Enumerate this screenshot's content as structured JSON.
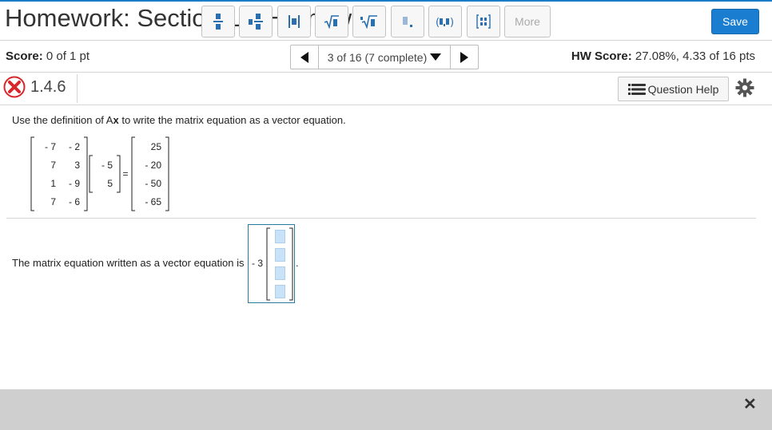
{
  "header": {
    "title": "Homework: Section 1.4 Homework",
    "save_label": "Save"
  },
  "status": {
    "score_label": "Score:",
    "score_value": "0 of 1 pt",
    "progress_text": "3 of 16 (7 complete)",
    "hw_score_label": "HW Score:",
    "hw_score_value": "27.08%, 4.33 of 16 pts"
  },
  "question": {
    "number": "1.4.6",
    "result": "incorrect",
    "help_label": "Question Help",
    "instruction_pre": "Use the definition of A",
    "instruction_bold": "x",
    "instruction_post": " to write the matrix equation as a vector equation.",
    "matrix_A": [
      [
        "- 7",
        "- 2"
      ],
      [
        "7",
        "3"
      ],
      [
        "1",
        "- 9"
      ],
      [
        "7",
        "- 6"
      ]
    ],
    "vector_x": [
      "- 5",
      "5"
    ],
    "equals": "=",
    "vector_b": [
      "25",
      "- 20",
      "- 50",
      "- 65"
    ],
    "answer_label": "The matrix equation written as a vector equation is",
    "answer_coefficient": "- 3",
    "answer_end": "."
  },
  "toolbar": {
    "buttons": [
      "fraction",
      "mixed-number",
      "absolute-value",
      "square-root",
      "nth-root",
      "decimal",
      "ordered-pair",
      "matrix"
    ],
    "more_label": "More",
    "close_label": "✕"
  },
  "colors": {
    "accent": "#1a7dd0",
    "incorrect": "#d9262a",
    "answer_border": "#2b7a9e"
  }
}
